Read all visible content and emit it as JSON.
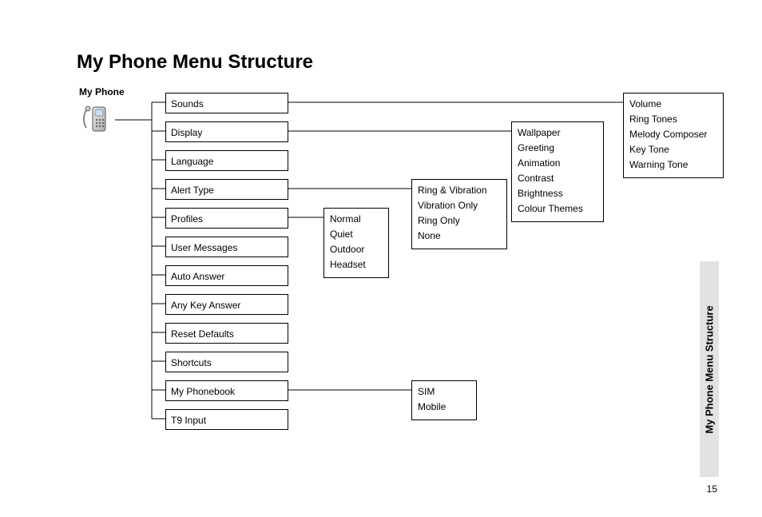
{
  "title": "My Phone Menu Structure",
  "root_label": "My Phone",
  "side_tab": "My Phone Menu Structure",
  "page_number": "15",
  "menu": [
    "Sounds",
    "Display",
    "Language",
    "Alert Type",
    "Profiles",
    "User Messages",
    "Auto Answer",
    "Any Key Answer",
    "Reset Defaults",
    "Shortcuts",
    "My Phonebook",
    "T9 Input"
  ],
  "profiles_sub": [
    "Normal",
    "Quiet",
    "Outdoor",
    "Headset"
  ],
  "alert_sub": [
    "Ring & Vibration",
    "Vibration Only",
    "Ring Only",
    "None"
  ],
  "display_sub": [
    "Wallpaper",
    "Greeting",
    "Animation",
    "Contrast",
    "Brightness",
    "Colour Themes"
  ],
  "sounds_sub": [
    "Volume",
    "Ring Tones",
    "Melody Composer",
    "Key Tone",
    "Warning Tone"
  ],
  "phonebook_sub": [
    "SIM",
    "Mobile"
  ]
}
